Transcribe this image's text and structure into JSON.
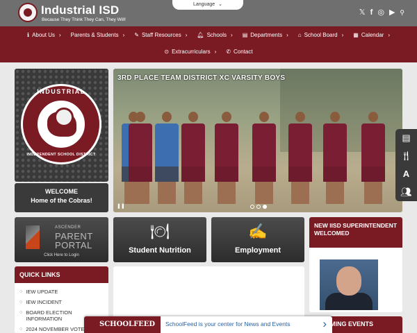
{
  "header": {
    "title": "Industrial ISD",
    "tagline": "Because They Think They Can, They Will!",
    "language_label": "Language",
    "social": [
      "x-icon",
      "facebook-icon",
      "instagram-icon",
      "youtube-icon",
      "search-icon"
    ]
  },
  "nav": {
    "row1": [
      {
        "label": "About Us",
        "icon": "info-icon"
      },
      {
        "label": "Parents & Students",
        "icon": ""
      },
      {
        "label": "Staff Resources",
        "icon": "pencil-icon"
      },
      {
        "label": "Schools",
        "icon": "bell-icon"
      },
      {
        "label": "Departments",
        "icon": "document-icon"
      },
      {
        "label": "School Board",
        "icon": "building-icon"
      },
      {
        "label": "Calendar",
        "icon": "calendar-icon"
      }
    ],
    "row2": [
      {
        "label": "Extracurriculars",
        "icon": "play-circle-icon"
      },
      {
        "label": "Contact",
        "icon": "phone-icon"
      }
    ]
  },
  "district_logo": {
    "top_text": "INDUSTRIAL",
    "bottom_text": "INDEPENDENT SCHOOL DISTRICT"
  },
  "welcome": {
    "line1": "WELCOME",
    "line2": "Home of the Cobras!"
  },
  "slideshow": {
    "caption": "3RD PLACE TEAM DISTRICT XC VARSITY BOYS",
    "slide_count": 3,
    "active_slide": 3
  },
  "tiles": {
    "ascender": {
      "top": "ASCENDER",
      "line1": "PARENT",
      "line2": "PORTAL",
      "footer": "Click Here to Login"
    },
    "nutrition": {
      "label": "Student Nutrition",
      "icon": "plate-icon"
    },
    "employment": {
      "label": "Employment",
      "icon": "application-icon"
    }
  },
  "quick_links": {
    "title": "QUICK LINKS",
    "items": [
      "IEW UPDATE",
      "IEW INCIDENT",
      "BOARD ELECTION INFORMATION",
      "2024 NOVEMBER VOTE"
    ]
  },
  "news": {
    "headline": "NEW IISD SUPERINTENDENT WELCOMED"
  },
  "events": {
    "title": "UPCOMING EVENTS"
  },
  "schoolfeed": {
    "brand": "SCHOOLFEED",
    "text": "SchoolFeed is your center for News and Events"
  },
  "colors": {
    "maroon": "#7a1a23",
    "header_gray": "#6f6f6f",
    "tile_dark": "#3a3a3a",
    "link_blue": "#2a5fa0"
  }
}
